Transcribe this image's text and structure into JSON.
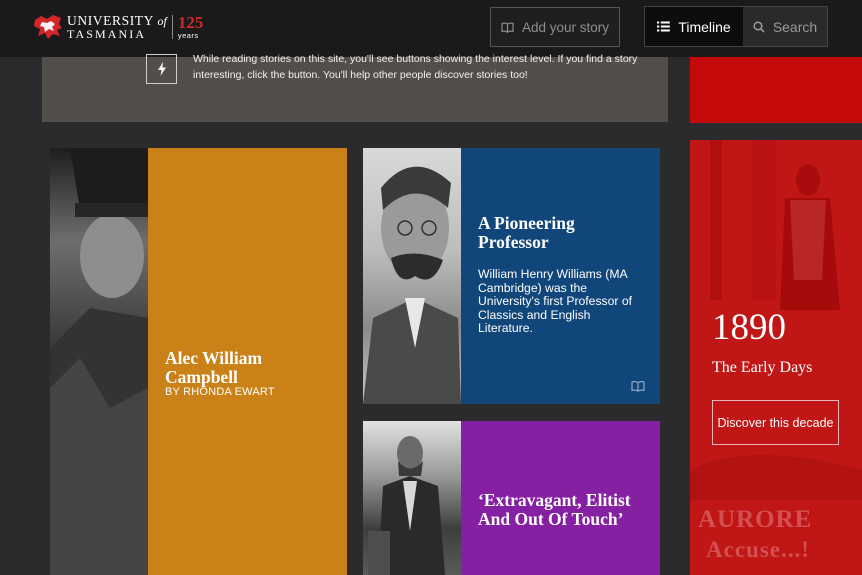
{
  "header": {
    "logo": {
      "line1": "UNIVERSITY",
      "line1_suffix": "of",
      "line2": "TASMANIA",
      "anniversary_number": "125",
      "anniversary_word": "years"
    },
    "add_story_label": "Add your story",
    "timeline_label": "Timeline",
    "search_label": "Search"
  },
  "intro": {
    "text": "While reading stories on this site, you'll see buttons showing the interest level. If you find a story interesting, click the button. You'll help other people discover stories too!"
  },
  "cards": [
    {
      "title": "Alec William Campbell",
      "byline": "BY RHONDA EWART",
      "color": "#c98118"
    },
    {
      "title": "A Pioneering Professor",
      "description": "William Henry Williams (MA Cambridge) was the University's first Professor of Classics and English Literature.",
      "color": "#11467a",
      "icon": "book-icon"
    },
    {
      "title": "‘Extravagant, Elitist And Out Of Touch’",
      "color": "#8520a3"
    }
  ],
  "decade": {
    "year": "1890",
    "label": "The Early Days",
    "button_label": "Discover this decade",
    "bg_text_1": "AURORE",
    "bg_text_2": "Accuse...!",
    "color": "#c21818"
  }
}
